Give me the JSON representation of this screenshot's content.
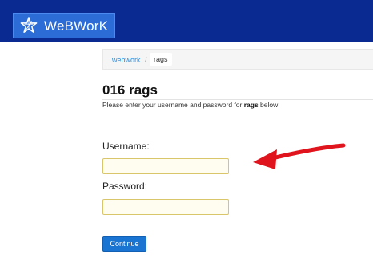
{
  "brand": {
    "name": "WeBWorK",
    "icon": "star-logo-icon"
  },
  "breadcrumb": {
    "root": "webwork",
    "separator": "/",
    "current": "rags"
  },
  "page": {
    "title": "016 rags",
    "intro_before": "Please enter your username and password for ",
    "intro_course": "rags",
    "intro_after": " below:"
  },
  "form": {
    "username_label": "Username:",
    "username_value": "",
    "password_label": "Password:",
    "password_value": "",
    "submit_label": "Continue"
  },
  "colors": {
    "topbar": "#0a2a91",
    "brand_box": "#2b6cd6",
    "link": "#2f8ad6",
    "button": "#1a74d2",
    "field_border": "#d9c56a",
    "arrow": "#e0141c"
  },
  "annotation": {
    "icon": "red-arrow-icon"
  }
}
